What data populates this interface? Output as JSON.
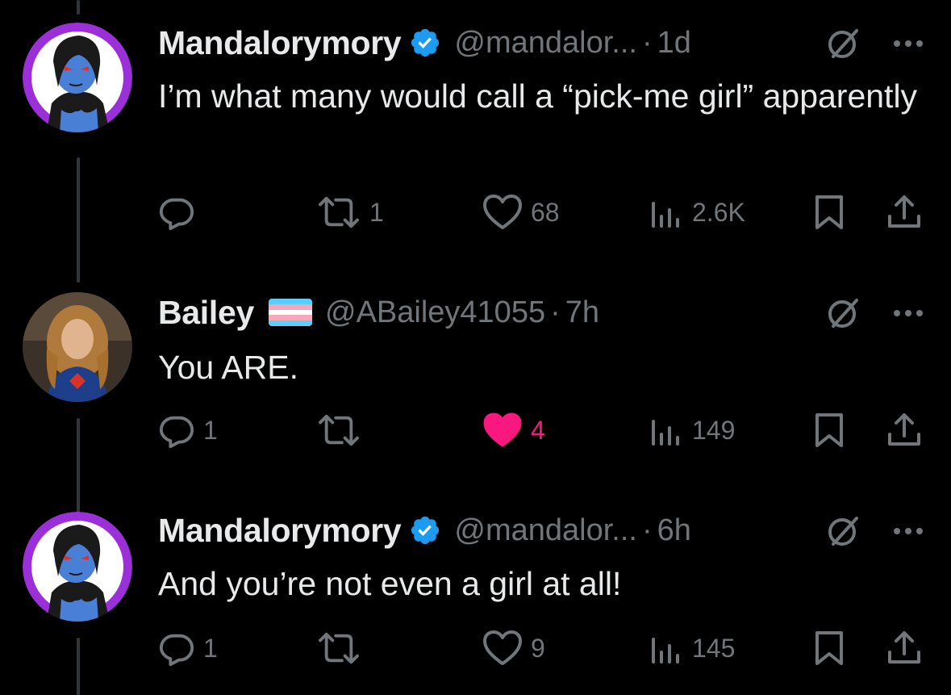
{
  "tweets": [
    {
      "display_name": "Mandalorymory",
      "verified": true,
      "handle": "@mandalor...",
      "separator": "·",
      "time": "1d",
      "text": "I’m what many would call a “pick-me girl” apparently",
      "replies": "",
      "retweets": "1",
      "likes": "68",
      "views": "2.6K",
      "liked": false,
      "avatar": "purple-ring-blue-character-avatar"
    },
    {
      "display_name": "Bailey",
      "flag": "transgender-pride-flag",
      "handle": "@ABailey41055",
      "separator": "·",
      "time": "7h",
      "text": "You ARE.",
      "replies": "1",
      "retweets": "",
      "likes": "4",
      "views": "149",
      "liked": true,
      "avatar": "photo-avatar-blonde-person"
    },
    {
      "display_name": "Mandalorymory",
      "verified": true,
      "handle": "@mandalor...",
      "separator": "·",
      "time": "6h",
      "text": "And you’re not even a girl at all!",
      "replies": "1",
      "retweets": "",
      "likes": "9",
      "views": "145",
      "liked": false,
      "avatar": "purple-ring-blue-character-avatar"
    }
  ],
  "colors": {
    "background": "#000000",
    "text_primary": "#e7e9ea",
    "text_secondary": "#71767b",
    "verified_blue": "#1d9bf0",
    "like_pink": "#f91880",
    "thread_line": "#333639",
    "avatar_ring_purple": "#9b30d9",
    "flag_blue": "#5bcefa",
    "flag_pink": "#f5a9b8",
    "flag_white": "#ffffff"
  },
  "icons": [
    "reply-icon",
    "retweet-icon",
    "like-icon",
    "views-icon",
    "bookmark-icon",
    "share-icon",
    "grok-icon",
    "more-icon",
    "verified-badge-icon"
  ]
}
